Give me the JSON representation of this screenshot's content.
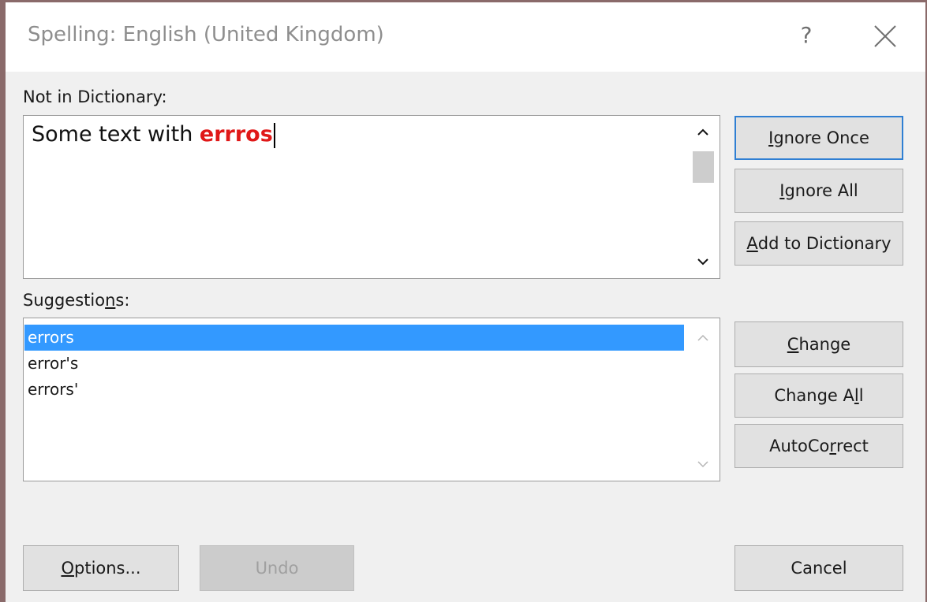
{
  "dialog": {
    "title": "Spelling: English (United Kingdom)",
    "help_glyph": "?",
    "close_glyph": "×"
  },
  "not_in_dictionary": {
    "label": "Not in Dictionary:",
    "text_before": "Some text with ",
    "error_word": "errros"
  },
  "suggestions": {
    "label_pre": "Suggestio",
    "label_accel": "n",
    "label_post": "s:",
    "items": [
      "errors",
      "error's",
      "errors'"
    ],
    "selected_index": 0
  },
  "buttons": {
    "ignore_once": {
      "accel": "I",
      "rest": "gnore Once"
    },
    "ignore_all": {
      "accel": "I",
      "rest": "gnore All"
    },
    "add_to_dictionary": {
      "accel": "A",
      "rest": "dd to Dictionary"
    },
    "change": {
      "accel": "C",
      "rest": "hange"
    },
    "change_all": {
      "pre": "Change A",
      "accel": "l",
      "post": "l"
    },
    "autocorrect": {
      "pre": "AutoCo",
      "accel": "r",
      "post": "rect"
    },
    "options": {
      "accel": "O",
      "rest": "ptions..."
    },
    "undo": "Undo",
    "cancel": "Cancel"
  },
  "colors": {
    "error_text": "#e01818",
    "selection": "#3399ff",
    "default_button_border": "#2f7fd3"
  }
}
